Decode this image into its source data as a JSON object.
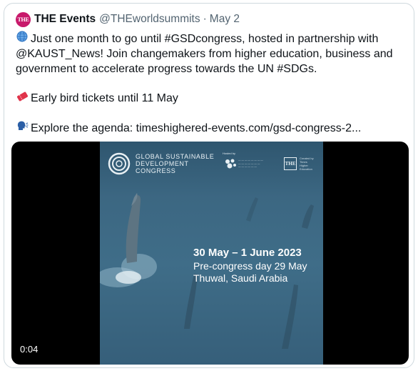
{
  "tweet": {
    "avatar_text": "THE",
    "display_name": "THE Events",
    "handle": "@THEworldsummits",
    "separator": "·",
    "date": "May 2",
    "line1": "Just one month to go until #GSDcongress, hosted in partnership with",
    "line2": "@KAUST_News! Join changemakers from higher education, business and",
    "line3": "government to accelerate progress towards the UN #SDGs.",
    "line4": "Early bird tickets until 11 May",
    "line5": "Explore the agenda: timeshighered-events.com/gsd-congress-2..."
  },
  "icons": {
    "globe": "globe-emoji-icon",
    "ticket": "ticket-emoji-icon",
    "speaking_head": "speaking-head-emoji-icon"
  },
  "video": {
    "logo_line1": "GLOBAL SUSTAINABLE",
    "logo_line2": "DEVELOPMENT",
    "logo_line3": "CONGRESS",
    "partner_label": "Hosted by",
    "the_logo_text": "THE",
    "the_line1": "Created by",
    "the_line2": "Times",
    "the_line3": "Higher",
    "the_line4": "Education",
    "dates": "30 May – 1 June 2023",
    "pre_congress": "Pre-congress day 29 May",
    "location": "Thuwal, Saudi Arabia",
    "timestamp": "0:04"
  },
  "colors": {
    "brand": "#c8196b",
    "text": "#0f1419",
    "muted": "#536471",
    "sea": "#3f6d88"
  }
}
